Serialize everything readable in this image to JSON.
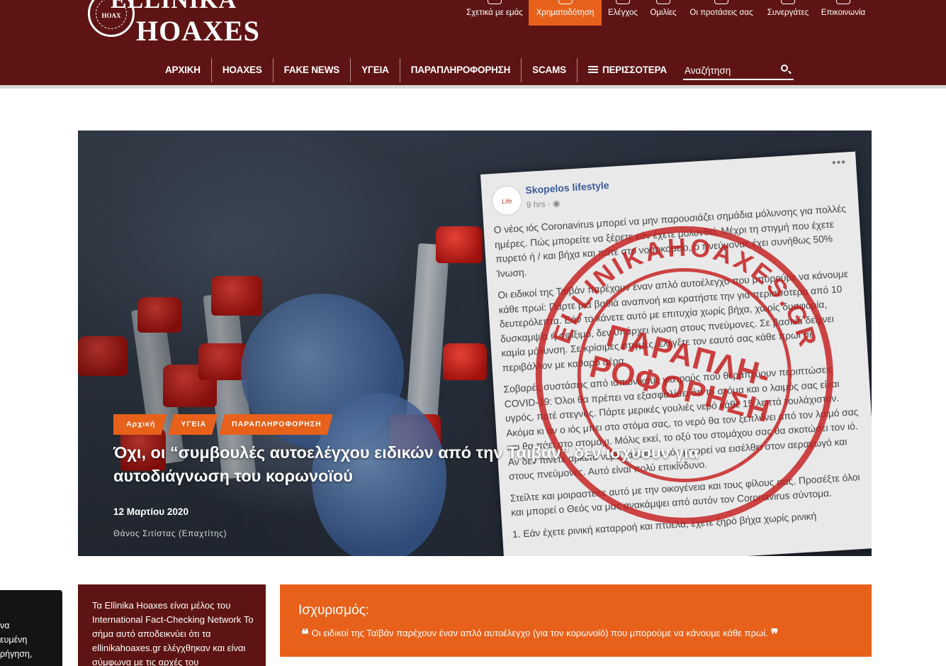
{
  "header": {
    "logo": {
      "top_text": "ELLINIKA",
      "main_text": "HOAXES",
      "seal_text": "HOAX"
    },
    "top_links": [
      {
        "label": "Σχετικά με εμάς",
        "icon": "handshake-icon"
      },
      {
        "label": "Χρηματοδότηση",
        "icon": "funding-icon",
        "active": true
      },
      {
        "label": "Ελέγχος",
        "icon": "magnifier-icon"
      },
      {
        "label": "Ομιλίες",
        "icon": "speech-icon"
      },
      {
        "label": "Οι προτάσεις σας",
        "icon": "suggestion-icon"
      },
      {
        "label": "Συνεργάτες",
        "icon": "partners-icon"
      },
      {
        "label": "Επικοινωνία",
        "icon": "phone-icon"
      }
    ],
    "main_nav": [
      "ΑΡΧΙΚΗ",
      "HOAXES",
      "FAKE NEWS",
      "ΥΓΕΙΑ",
      "ΠΑΡΑΠΛΗΡΟΦΟΡΗΣΗ",
      "SCAMS",
      "ΠΕΡΙΣΣΟΤΕΡΑ"
    ],
    "search_placeholder": "Αναζήτηση"
  },
  "hero": {
    "breadcrumbs": [
      "Αρχική",
      "ΥΓΕΙΑ",
      "ΠΑΡΑΠΛΗΡΟΦΟΡΗΣΗ"
    ],
    "title": "Όχι, οι “συμβουλές αυτοελέγχου ειδικών από την Ταϊβάν” δεν ισχύουν για αυτοδιάγνωση του κορωνοϊού",
    "date": "12 Μαρτίου 2020",
    "author": "Θάνος Σιτίστας (Επαχτίτης)",
    "post": {
      "avatar_text": "Life",
      "name": "Skopelos lifestyle",
      "time": "9 hrs · ◉",
      "dots": "•••",
      "paragraphs": [
        "Ο νέος ιός Coronavirus μπορεί να μην παρουσιάζει σημάδια μόλυνσης για πολλές ημέρες. Πώς μπορείτε να ξέρετε εάν έχετε μολυνθεί; Μέχρι τη στιγμή που έχετε πυρετό ή / και βήχα και πάτε στο νοσοκομείο, ο πνεύμονας έχει συνήθως 50% Ίνωση.",
        "Οι ειδικοί της Ταϊβάν παρέχουν έναν απλό αυτοέλεγχο που μπορούμε να κάνουμε κάθε πρωί: Πάρτε μια βαθιά αναπνοή και κρατήστε την για περισσότερο από 10 δευτερόλεπτα. Εάν το κάνετε αυτό με επιτυχία χωρίς βήχα, χωρίς δυσφορία, δυσκαμψία ή σφίξιμο, δεν υπάρχει ίνωση στους πνεύμονες. Σε βασικά δείχνει καμία μόλυνση. Σε κρίσιμες στιγμές, ελέγξτε τον εαυτό σας κάθε πρωί σε περιβάλλον με καθαρό αέρα.",
        "Σοβαρές συστάσεις από ιαπωνικούς γιατρούς που θεραπεύουν περιπτώσεις COVID-19: Όλοι θα πρέπει να εξασφαλίσει ότι το στόμα και ο λαιμός σας είναι υγρός, ποτέ στεγνός. Πάρτε μερικές γουλιές νερό κάθε 15 λεπτά τουλάχιστον. Ακόμα κι αν ο ιός μπει στο στόμα σας, το νερό θα τον ξεπλύνει από τον λαιμό σας και θα πάει στο στομάχι. Μόλις εκεί, το οξύ του στομάχου σας θα σκοτώσει τον ιό. Αν δεν πίνετε αρκετό νερό τακτικά, ο ιός μπορεί να εισέλθει στον αεραγωγό και στους πνεύμονες. Αυτό είναι πολύ επικίνδυνο.",
        "Στείλτε και μοιραστείτε αυτό με την οικογένεια και τους φίλους σας. Προσέξτε όλοι και μπορεί ο Θεός να μας ανακάμψει από αυτόν τον Coronavirus σύντομα.",
        "1. Εάν έχετε ρινική καταρροή και πτύελα, έχετε ξηρό βήχα χωρίς ρινική"
      ],
      "stamp_text": "ΠΑΡΑΠΛΗ-ΡΟΦΟΡΗΣΗ",
      "stamp_ring": "ELLINIKAHOAXES.GR"
    }
  },
  "bottom": {
    "dark_tab_lines": [
      "να",
      "ευμένη",
      "ρήγηση,"
    ],
    "ifcn_text": "Τα Ellinika Hoaxes είναι μέλος του International Fact-Checking Network Το σήμα αυτό αποδεικνύει ότι τα ellinikahoaxes.gr ελέγχθηκαν και είναι σύμφωνα με τις αρχές του",
    "claim_label": "Ισχυρισμός:",
    "claim_text": "Οι ειδικοί της Ταϊβάν παρέχουν έναν απλό αυτοέλεγχο (για τον κορωνοϊό) που μπορούμε να κάνουμε κάθε πρωί.",
    "quote_open": "❝",
    "quote_close": "❞"
  },
  "colors": {
    "header_bg": "#5e1414",
    "accent": "#e8611a",
    "stamp_red": "#c41919"
  }
}
